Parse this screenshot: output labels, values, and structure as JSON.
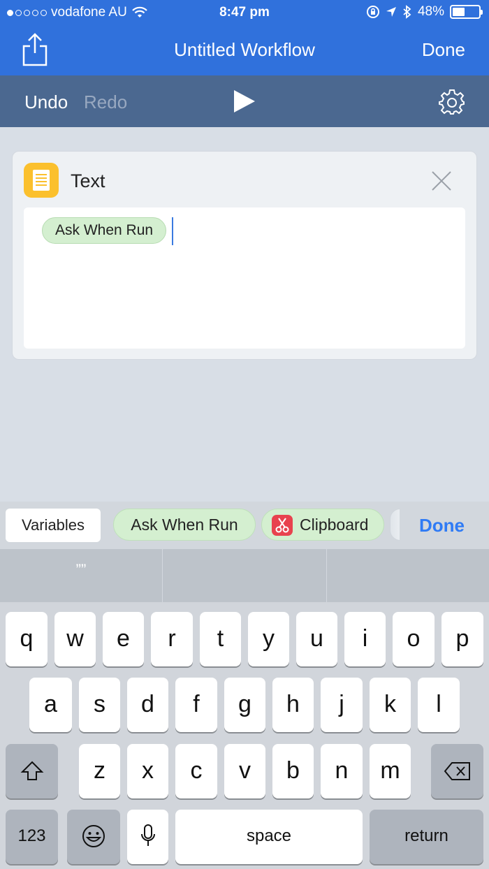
{
  "status": {
    "carrier": "vodafone AU",
    "signal_dots": 5,
    "signal_filled": 1,
    "time": "8:47 pm",
    "battery": "48%",
    "battery_level": 0.48
  },
  "navbar": {
    "title": "Untitled Workflow",
    "done_label": "Done",
    "share_icon": "share-icon"
  },
  "toolbar": {
    "undo_label": "Undo",
    "redo_label": "Redo",
    "play_icon": "play-icon",
    "settings_icon": "gear-icon"
  },
  "action_card": {
    "title": "Text",
    "icon": "text-document-icon",
    "icon_color": "#fbc02d",
    "close_icon": "close-icon",
    "token_label": "Ask When Run"
  },
  "variable_bar": {
    "variables_label": "Variables",
    "chips": [
      {
        "label": "Ask When Run"
      },
      {
        "label": "Clipboard",
        "icon": "scissors-icon"
      }
    ],
    "done_label": "Done"
  },
  "predictive": {
    "suggestions": [
      "””",
      "",
      ""
    ]
  },
  "keyboard": {
    "row1": [
      "q",
      "w",
      "e",
      "r",
      "t",
      "y",
      "u",
      "i",
      "o",
      "p"
    ],
    "row2": [
      "a",
      "s",
      "d",
      "f",
      "g",
      "h",
      "j",
      "k",
      "l"
    ],
    "row3": [
      "z",
      "x",
      "c",
      "v",
      "b",
      "n",
      "m"
    ],
    "numbers_label": "123",
    "space_label": "space",
    "return_label": "return",
    "shift_icon": "shift-icon",
    "delete_icon": "delete-icon",
    "emoji_icon": "emoji-icon",
    "mic_icon": "microphone-icon"
  }
}
